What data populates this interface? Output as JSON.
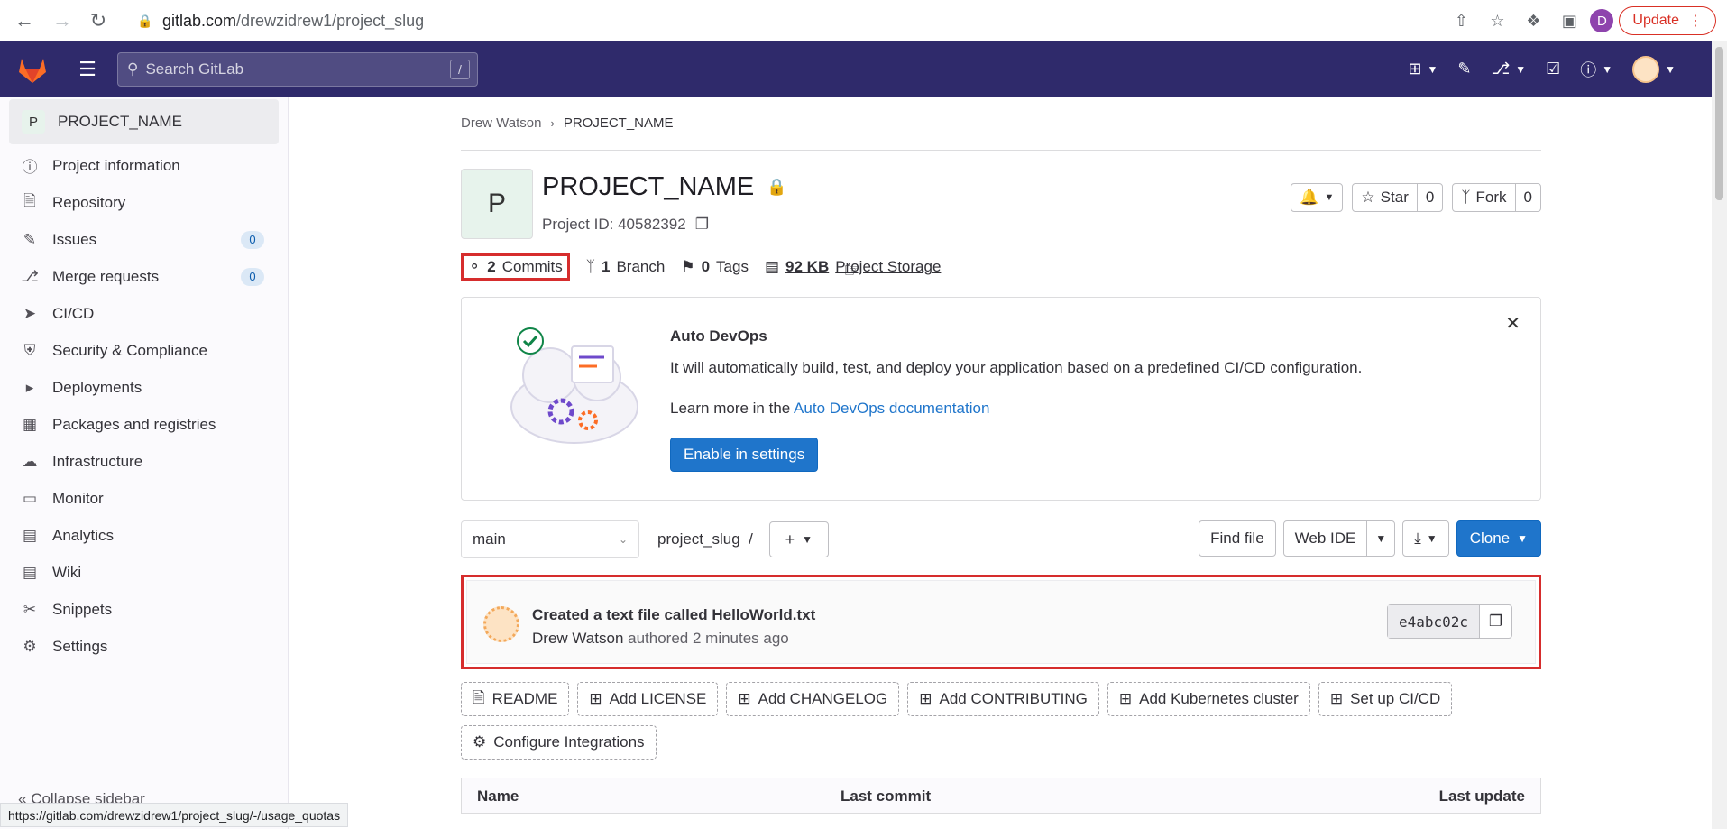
{
  "browser": {
    "url_host": "gitlab.com",
    "url_path": "/drewzidrew1/project_slug",
    "profile_initial": "D",
    "update_label": "Update",
    "status_url": "https://gitlab.com/drewzidrew1/project_slug/-/usage_quotas"
  },
  "topnav": {
    "search_placeholder": "Search GitLab",
    "search_shortcut": "/"
  },
  "sidebar": {
    "project_initial": "P",
    "project_name": "PROJECT_NAME",
    "items": [
      {
        "label": "Project information",
        "icon": "info-icon"
      },
      {
        "label": "Repository",
        "icon": "doc-icon"
      },
      {
        "label": "Issues",
        "icon": "issues-icon",
        "count": "0"
      },
      {
        "label": "Merge requests",
        "icon": "merge-icon",
        "count": "0"
      },
      {
        "label": "CI/CD",
        "icon": "rocket-icon"
      },
      {
        "label": "Security & Compliance",
        "icon": "shield-icon"
      },
      {
        "label": "Deployments",
        "icon": "deploy-icon"
      },
      {
        "label": "Packages and registries",
        "icon": "package-icon"
      },
      {
        "label": "Infrastructure",
        "icon": "cloud-icon"
      },
      {
        "label": "Monitor",
        "icon": "monitor-icon"
      },
      {
        "label": "Analytics",
        "icon": "chart-icon"
      },
      {
        "label": "Wiki",
        "icon": "book-icon"
      },
      {
        "label": "Snippets",
        "icon": "scissors-icon"
      },
      {
        "label": "Settings",
        "icon": "gear-icon"
      }
    ],
    "collapse_label": "Collapse sidebar"
  },
  "main": {
    "breadcrumb": {
      "parent": "Drew Watson",
      "current": "PROJECT_NAME"
    },
    "project_initial": "P",
    "title": "PROJECT_NAME",
    "project_id": "Project ID: 40582392",
    "star_label": "Star",
    "star_count": "0",
    "fork_label": "Fork",
    "fork_count": "0",
    "stats": {
      "commits_num": "2",
      "commits_label": "Commits",
      "branch_num": "1",
      "branch_label": "Branch",
      "tags_num": "0",
      "tags_label": "Tags",
      "storage_num": "92 KB",
      "storage_label": "Project Storage"
    },
    "devops": {
      "title": "Auto DevOps",
      "text": "It will automatically build, test, and deploy your application based on a predefined CI/CD configuration.",
      "learn_prefix": "Learn more in the",
      "learn_link": "Auto DevOps documentation",
      "enable_label": "Enable in settings"
    },
    "branch": {
      "selected": "main",
      "path": "project_slug",
      "separator": "/",
      "find_file": "Find file",
      "web_ide": "Web IDE",
      "clone": "Clone"
    },
    "commit": {
      "title": "Created a text file called HelloWorld.txt",
      "author": "Drew Watson",
      "meta": "authored 2 minutes ago",
      "sha": "e4abc02c"
    },
    "quick_actions": [
      {
        "label": "README",
        "icon": "file-icon"
      },
      {
        "label": "Add LICENSE",
        "icon": "plus-square-icon"
      },
      {
        "label": "Add CHANGELOG",
        "icon": "plus-square-icon"
      },
      {
        "label": "Add CONTRIBUTING",
        "icon": "plus-square-icon"
      },
      {
        "label": "Add Kubernetes cluster",
        "icon": "plus-square-icon"
      },
      {
        "label": "Set up CI/CD",
        "icon": "plus-square-icon"
      },
      {
        "label": "Configure Integrations",
        "icon": "gear-icon"
      }
    ],
    "table": {
      "col_name": "Name",
      "col_commit": "Last commit",
      "col_update": "Last update"
    }
  },
  "colors": {
    "topnav": "#2f2a6b",
    "primary": "#1f75cb",
    "highlight": "#d62d2d"
  }
}
